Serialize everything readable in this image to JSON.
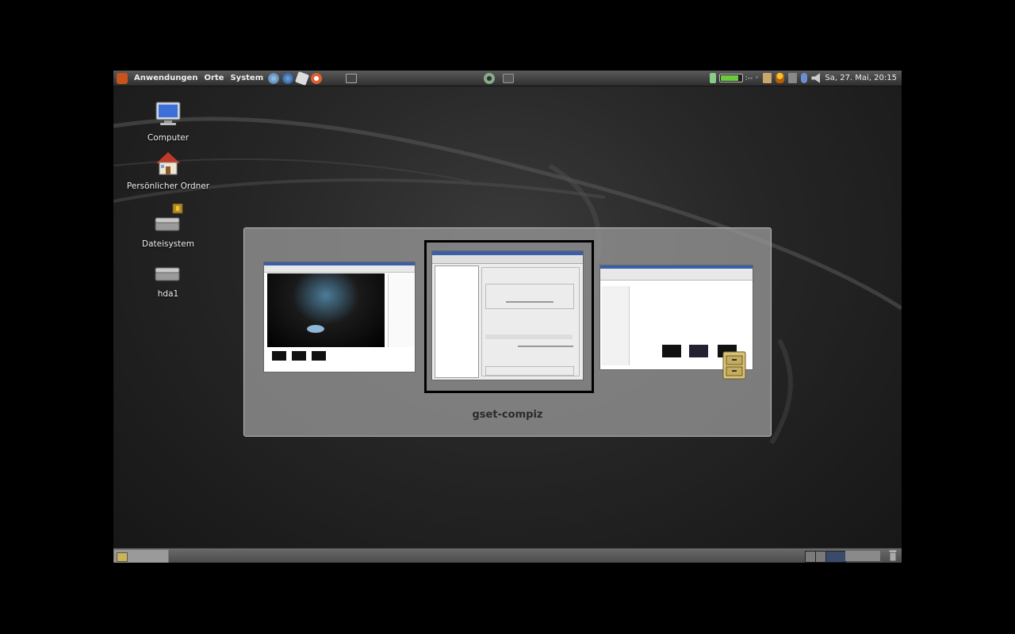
{
  "top_panel": {
    "menu": [
      "Anwendungen",
      "Orte",
      "System"
    ],
    "battery_level": 0.85,
    "tray_text": ":-- ◦",
    "clock": "Sa, 27. Mai, 20:15"
  },
  "desktop": {
    "icons": [
      {
        "label": "Computer",
        "icon": "computer-icon"
      },
      {
        "label": "Persönlicher Ordner",
        "icon": "home-folder-icon"
      },
      {
        "label": "Dateisystem",
        "icon": "drive-icon"
      },
      {
        "label": "hda1",
        "icon": "drive-icon"
      }
    ]
  },
  "switcher": {
    "selected_title": "gset-compiz",
    "windows": [
      {
        "icon": "image-viewer-window"
      },
      {
        "icon": "compiz-settings-window"
      },
      {
        "icon": "file-manager-window"
      }
    ]
  },
  "colors": {
    "accent": "#6acb3c",
    "workspace_active": "#394a6a"
  }
}
